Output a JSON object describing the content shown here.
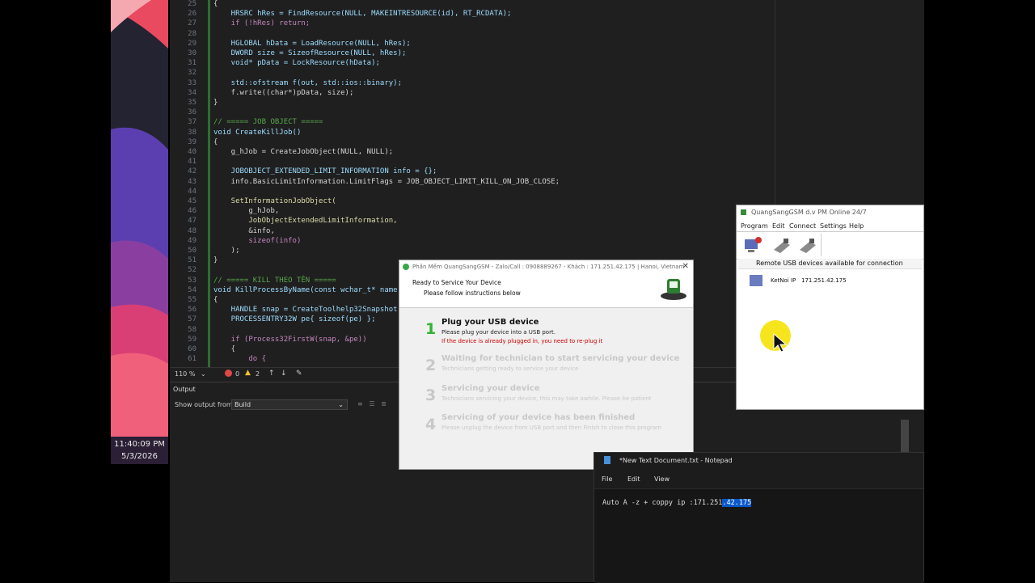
{
  "taskbar": {
    "time": "11:40:09 PM",
    "date": "5/3/2026"
  },
  "editor": {
    "lines": [
      {
        "n": "25",
        "t": "{"
      },
      {
        "n": "26",
        "t": "    HRSRC hRes = FindResource(NULL, MAKEINTRESOURCE(id), RT_RCDATA);"
      },
      {
        "n": "27",
        "t": "    if (!hRes) return;"
      },
      {
        "n": "28",
        "t": ""
      },
      {
        "n": "29",
        "t": "    HGLOBAL hData = LoadResource(NULL, hRes);"
      },
      {
        "n": "30",
        "t": "    DWORD size = SizeofResource(NULL, hRes);"
      },
      {
        "n": "31",
        "t": "    void* pData = LockResource(hData);"
      },
      {
        "n": "32",
        "t": ""
      },
      {
        "n": "33",
        "t": "    std::ofstream f(out, std::ios::binary);"
      },
      {
        "n": "34",
        "t": "    f.write((char*)pData, size);"
      },
      {
        "n": "35",
        "t": "}"
      },
      {
        "n": "36",
        "t": ""
      },
      {
        "n": "37",
        "t": "// ===== JOB OBJECT ====="
      },
      {
        "n": "38",
        "t": "void CreateKillJob()"
      },
      {
        "n": "39",
        "t": "{"
      },
      {
        "n": "40",
        "t": "    g_hJob = CreateJobObject(NULL, NULL);"
      },
      {
        "n": "41",
        "t": ""
      },
      {
        "n": "42",
        "t": "    JOBOBJECT_EXTENDED_LIMIT_INFORMATION info = {};"
      },
      {
        "n": "43",
        "t": "    info.BasicLimitInformation.LimitFlags = JOB_OBJECT_LIMIT_KILL_ON_JOB_CLOSE;"
      },
      {
        "n": "44",
        "t": ""
      },
      {
        "n": "45",
        "t": "    SetInformationJobObject("
      },
      {
        "n": "46",
        "t": "        g_hJob,"
      },
      {
        "n": "47",
        "t": "        JobObjectExtendedLimitInformation,"
      },
      {
        "n": "48",
        "t": "        &info,"
      },
      {
        "n": "49",
        "t": "        sizeof(info)"
      },
      {
        "n": "50",
        "t": "    );"
      },
      {
        "n": "51",
        "t": "}"
      },
      {
        "n": "52",
        "t": ""
      },
      {
        "n": "53",
        "t": "// ===== KILL THEO TÊN ====="
      },
      {
        "n": "54",
        "t": "void KillProcessByName(const wchar_t* name"
      },
      {
        "n": "55",
        "t": "{"
      },
      {
        "n": "56",
        "t": "    HANDLE snap = CreateToolhelp32Snapshot"
      },
      {
        "n": "57",
        "t": "    PROCESSENTRY32W pe{ sizeof(pe) };"
      },
      {
        "n": "58",
        "t": ""
      },
      {
        "n": "59",
        "t": "    if (Process32FirstW(snap, &pe))"
      },
      {
        "n": "60",
        "t": "    {"
      },
      {
        "n": "61",
        "t": "        do {"
      }
    ]
  },
  "statusbar": {
    "zoom": "110 %",
    "errors": "0",
    "warnings": "2"
  },
  "output": {
    "tab": "Output",
    "show_from_label": "Show output from:",
    "source": "Build"
  },
  "dialog": {
    "title": "Phần Mềm QuangSangGSM - Zalo/Call : 0908889267 - Khách : 171.251.42.175 | Hanoi, Vietnam",
    "header_title": "Ready to Service Your Device",
    "header_sub": "Please follow instructions below",
    "steps": [
      {
        "num": "1",
        "title": "Plug your USB device",
        "line1": "Please plug your device into a USB port.",
        "line2": "If the device is already plugged in, you need to re-plug it"
      },
      {
        "num": "2",
        "title": "Waiting for technician to start servicing your device",
        "line1": "Technicians getting ready to service your device"
      },
      {
        "num": "3",
        "title": "Servicing your device",
        "line1": "Technicians servicing your device, this may take awhile. Please be patient"
      },
      {
        "num": "4",
        "title": "Servicing of your device has been finished",
        "line1": "Please unplug the device from USB port and then Finish to close this program"
      }
    ],
    "colors": {
      "active_num": "#2fb52f",
      "warn_text": "#d00000",
      "inactive": "#c8c8c8"
    }
  },
  "remote": {
    "title": "QuangSangGSM d.v PM Online 24/7",
    "menu": [
      "Program",
      "Edit",
      "Connect",
      "Settings",
      "Help"
    ],
    "list_title": "Remote USB devices available for connection",
    "device_name": "KetNoi IP",
    "device_ip": "171.251.42.175"
  },
  "notepad": {
    "title": "*New Text Document.txt - Notepad",
    "menu": [
      "File",
      "Edit",
      "View"
    ],
    "text_before": "Auto A -z + coppy ip :171.251",
    "text_selected": ".42.175"
  }
}
